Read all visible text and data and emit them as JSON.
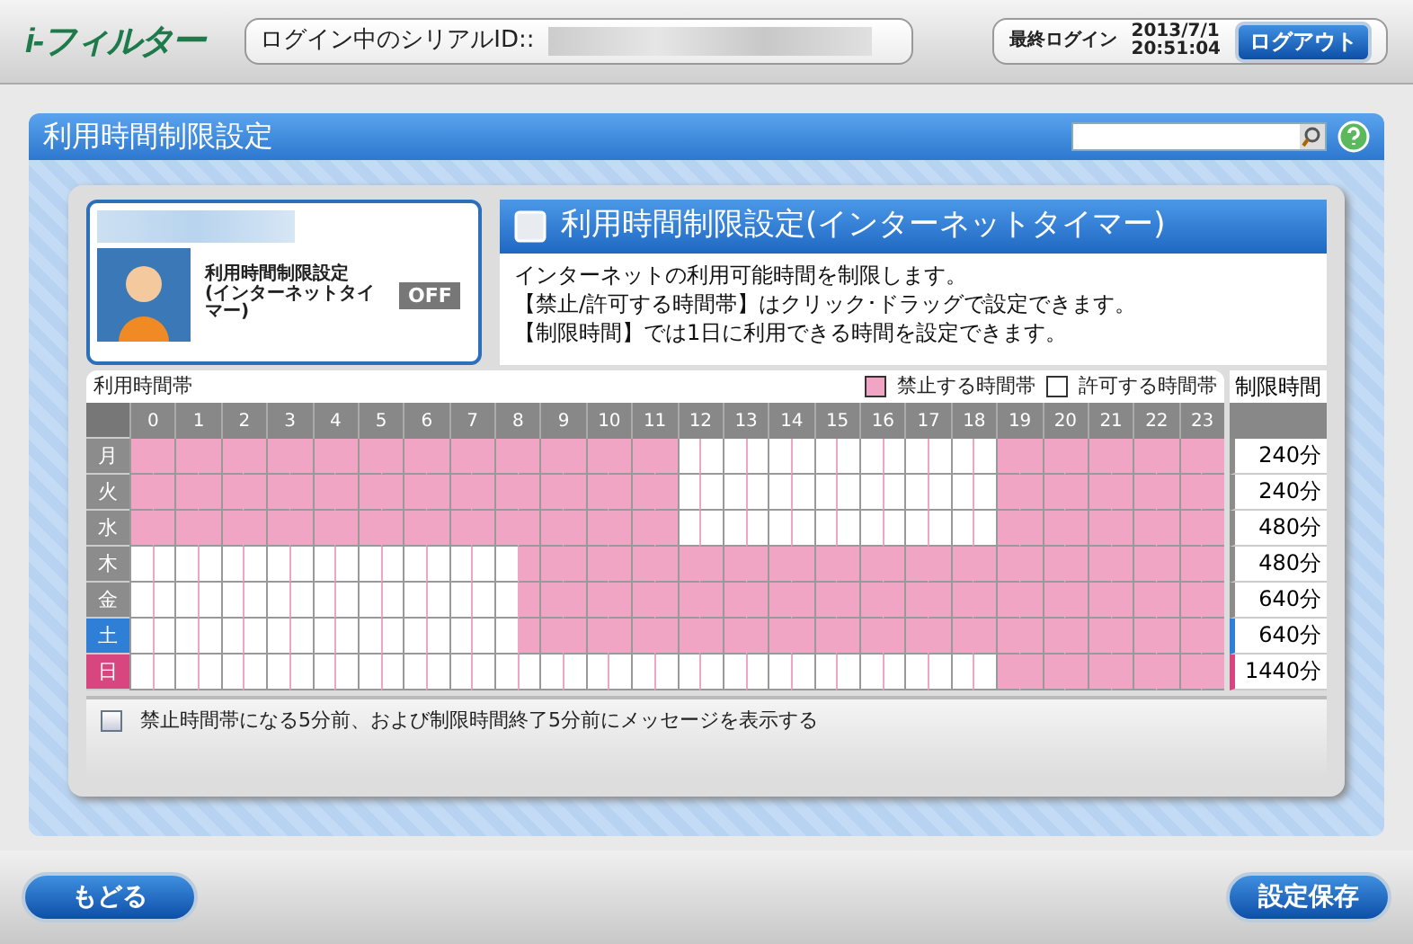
{
  "header": {
    "logo": "i-フィルター",
    "serial_label": "ログイン中のシリアルID::",
    "last_login_label": "最終ログイン",
    "last_login_date": "2013/7/1",
    "last_login_time": "20:51:04",
    "logout": "ログアウト"
  },
  "panel": {
    "title": "利用時間制限設定"
  },
  "profile": {
    "setting": "利用時間制限設定\n(インターネットタイマー)",
    "status": "OFF",
    "on": false
  },
  "intro": {
    "title": "利用時間制限設定(インターネットタイマー)",
    "lines": [
      "インターネットの利用可能時間を制限します。",
      "【禁止/許可する時間帯】はクリック･ドラッグで設定できます。",
      "【制限時間】では1日に利用できる時間を設定できます。"
    ]
  },
  "schedule": {
    "title": "利用時間帯",
    "legend_blocked": "禁止する時間帯",
    "legend_allowed": "許可する時間帯",
    "limit_title": "制限時間",
    "hours": [
      "0",
      "1",
      "2",
      "3",
      "4",
      "5",
      "6",
      "7",
      "8",
      "9",
      "10",
      "11",
      "12",
      "13",
      "14",
      "15",
      "16",
      "17",
      "18",
      "19",
      "20",
      "21",
      "22",
      "23"
    ],
    "days": [
      {
        "label": "月",
        "limit": "240分",
        "color": "#8c8c8c",
        "blocked": [
          true,
          true,
          true,
          true,
          true,
          true,
          true,
          true,
          true,
          true,
          true,
          true,
          true,
          true,
          true,
          true,
          true,
          true,
          true,
          true,
          true,
          true,
          true,
          true,
          false,
          false,
          false,
          false,
          false,
          false,
          false,
          false,
          false,
          false,
          false,
          false,
          false,
          false,
          true,
          true,
          true,
          true,
          true,
          true,
          true,
          true,
          true,
          true
        ]
      },
      {
        "label": "火",
        "limit": "240分",
        "color": "#8c8c8c",
        "blocked": [
          true,
          true,
          true,
          true,
          true,
          true,
          true,
          true,
          true,
          true,
          true,
          true,
          true,
          true,
          true,
          true,
          true,
          true,
          true,
          true,
          true,
          true,
          true,
          true,
          false,
          false,
          false,
          false,
          false,
          false,
          false,
          false,
          false,
          false,
          false,
          false,
          false,
          false,
          true,
          true,
          true,
          true,
          true,
          true,
          true,
          true,
          true,
          true
        ]
      },
      {
        "label": "水",
        "limit": "480分",
        "color": "#8c8c8c",
        "blocked": [
          true,
          true,
          true,
          true,
          true,
          true,
          true,
          true,
          true,
          true,
          true,
          true,
          true,
          true,
          true,
          true,
          true,
          true,
          true,
          true,
          true,
          true,
          true,
          true,
          false,
          false,
          false,
          false,
          false,
          false,
          false,
          false,
          false,
          false,
          false,
          false,
          false,
          false,
          true,
          true,
          true,
          true,
          true,
          true,
          true,
          true,
          true,
          true
        ]
      },
      {
        "label": "木",
        "limit": "480分",
        "color": "#8c8c8c",
        "blocked": [
          false,
          false,
          false,
          false,
          false,
          false,
          false,
          false,
          false,
          false,
          false,
          false,
          false,
          false,
          false,
          false,
          false,
          true,
          true,
          true,
          true,
          true,
          true,
          true,
          true,
          true,
          true,
          true,
          true,
          true,
          true,
          true,
          true,
          true,
          true,
          true,
          true,
          true,
          true,
          true,
          true,
          true,
          true,
          true,
          true,
          true,
          true,
          true
        ]
      },
      {
        "label": "金",
        "limit": "640分",
        "color": "#8c8c8c",
        "blocked": [
          false,
          false,
          false,
          false,
          false,
          false,
          false,
          false,
          false,
          false,
          false,
          false,
          false,
          false,
          false,
          false,
          false,
          true,
          true,
          true,
          true,
          true,
          true,
          true,
          true,
          true,
          true,
          true,
          true,
          true,
          true,
          true,
          true,
          true,
          true,
          true,
          true,
          true,
          true,
          true,
          true,
          true,
          true,
          true,
          true,
          true,
          true,
          true
        ]
      },
      {
        "label": "土",
        "limit": "640分",
        "color": "#2f7fd6",
        "blocked": [
          false,
          false,
          false,
          false,
          false,
          false,
          false,
          false,
          false,
          false,
          false,
          false,
          false,
          false,
          false,
          false,
          false,
          true,
          true,
          true,
          true,
          true,
          true,
          true,
          true,
          true,
          true,
          true,
          true,
          true,
          true,
          true,
          true,
          true,
          true,
          true,
          true,
          true,
          true,
          true,
          true,
          true,
          true,
          true,
          true,
          true,
          true,
          true
        ]
      },
      {
        "label": "日",
        "limit": "1440分",
        "color": "#d8467f",
        "blocked": [
          false,
          false,
          false,
          false,
          false,
          false,
          false,
          false,
          false,
          false,
          false,
          false,
          false,
          false,
          false,
          false,
          false,
          false,
          false,
          false,
          false,
          false,
          false,
          false,
          false,
          false,
          false,
          false,
          false,
          false,
          false,
          false,
          false,
          false,
          false,
          false,
          false,
          false,
          true,
          true,
          true,
          true,
          true,
          true,
          true,
          true,
          true,
          true
        ]
      }
    ],
    "notice": {
      "label": "禁止時間帯になる5分前、および制限時間終了5分前にメッセージを表示する",
      "checked": false
    }
  },
  "footer": {
    "back": "もどる",
    "save": "設定保存"
  }
}
